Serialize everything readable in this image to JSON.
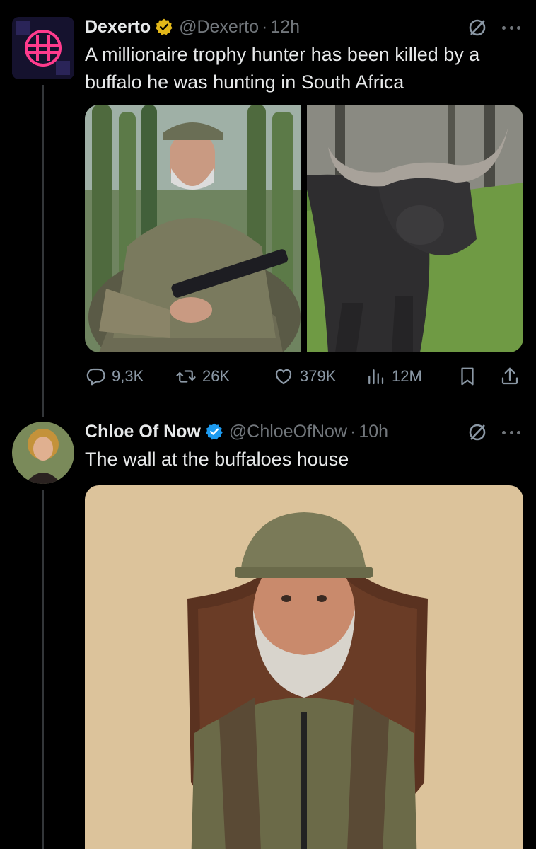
{
  "tweets": [
    {
      "name": "Dexerto",
      "handle": "@Dexerto",
      "separator": "·",
      "time": "12h",
      "verified": "gold",
      "text": "A millionaire trophy hunter has been killed by a buffalo he was hunting in South Africa",
      "media": [
        "photo-hunter-with-rifle",
        "photo-cape-buffalo"
      ],
      "stats": {
        "replies": "9,3K",
        "reposts": "26K",
        "likes": "379K",
        "views": "12M"
      }
    },
    {
      "name": "Chloe Of Now",
      "handle": "@ChloeOfNow",
      "separator": "·",
      "time": "10h",
      "verified": "blue",
      "text": "The wall at the buffaloes house",
      "media": [
        "photo-hunter-mounted-on-wall"
      ]
    }
  ],
  "colors": {
    "background": "#000000",
    "text": "#e7e9ea",
    "muted": "#71767b",
    "gold_badge": "#e2b719",
    "blue_badge": "#1d9bf0",
    "thread_line": "#333639"
  }
}
